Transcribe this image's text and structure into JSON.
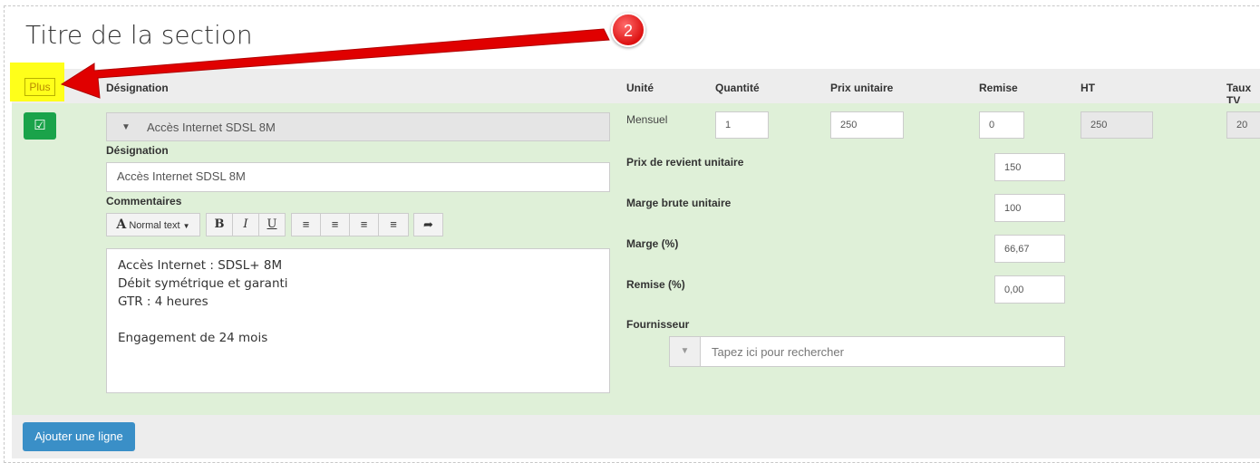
{
  "section_title": "Titre de la section",
  "plus_button": "Plus",
  "columns": {
    "designation": "Désignation",
    "unite": "Unité",
    "quantite": "Quantité",
    "prix_unitaire": "Prix unitaire",
    "remise": "Remise",
    "ht": "HT",
    "taux_tva": "Taux TV"
  },
  "line": {
    "product_select": "Accès Internet SDSL 8M",
    "unit": "Mensuel",
    "quantity": "1",
    "unit_price": "250",
    "discount": "0",
    "ht": "250",
    "tva_rate": "20",
    "designation_label": "Désignation",
    "designation_value": "Accès Internet SDSL 8M",
    "comments_label": "Commentaires",
    "comments_lines": [
      "Accès Internet : SDSL+ 8M",
      "Débit symétrique et garanti",
      "GTR : 4 heures",
      "",
      "Engagement de 24 mois"
    ],
    "cost_price_label": "Prix de revient unitaire",
    "cost_price": "150",
    "gross_margin_label": "Marge brute unitaire",
    "gross_margin": "100",
    "margin_pct_label": "Marge (%)",
    "margin_pct": "66,67",
    "discount_pct_label": "Remise (%)",
    "discount_pct": "0,00",
    "supplier_label": "Fournisseur",
    "supplier_placeholder": "Tapez ici pour rechercher"
  },
  "toolbar": {
    "text_style": "Normal text",
    "text_style_icon": "A",
    "bold": "B",
    "italic": "I",
    "underline": "U"
  },
  "add_line_button": "Ajouter une ligne",
  "annotation_number": "2",
  "colors": {
    "row_bg": "#dff0d8",
    "highlight": "#ffff1a",
    "check": "#1aa34a",
    "add_button": "#3a8fc7",
    "arrow": "#e00000"
  }
}
